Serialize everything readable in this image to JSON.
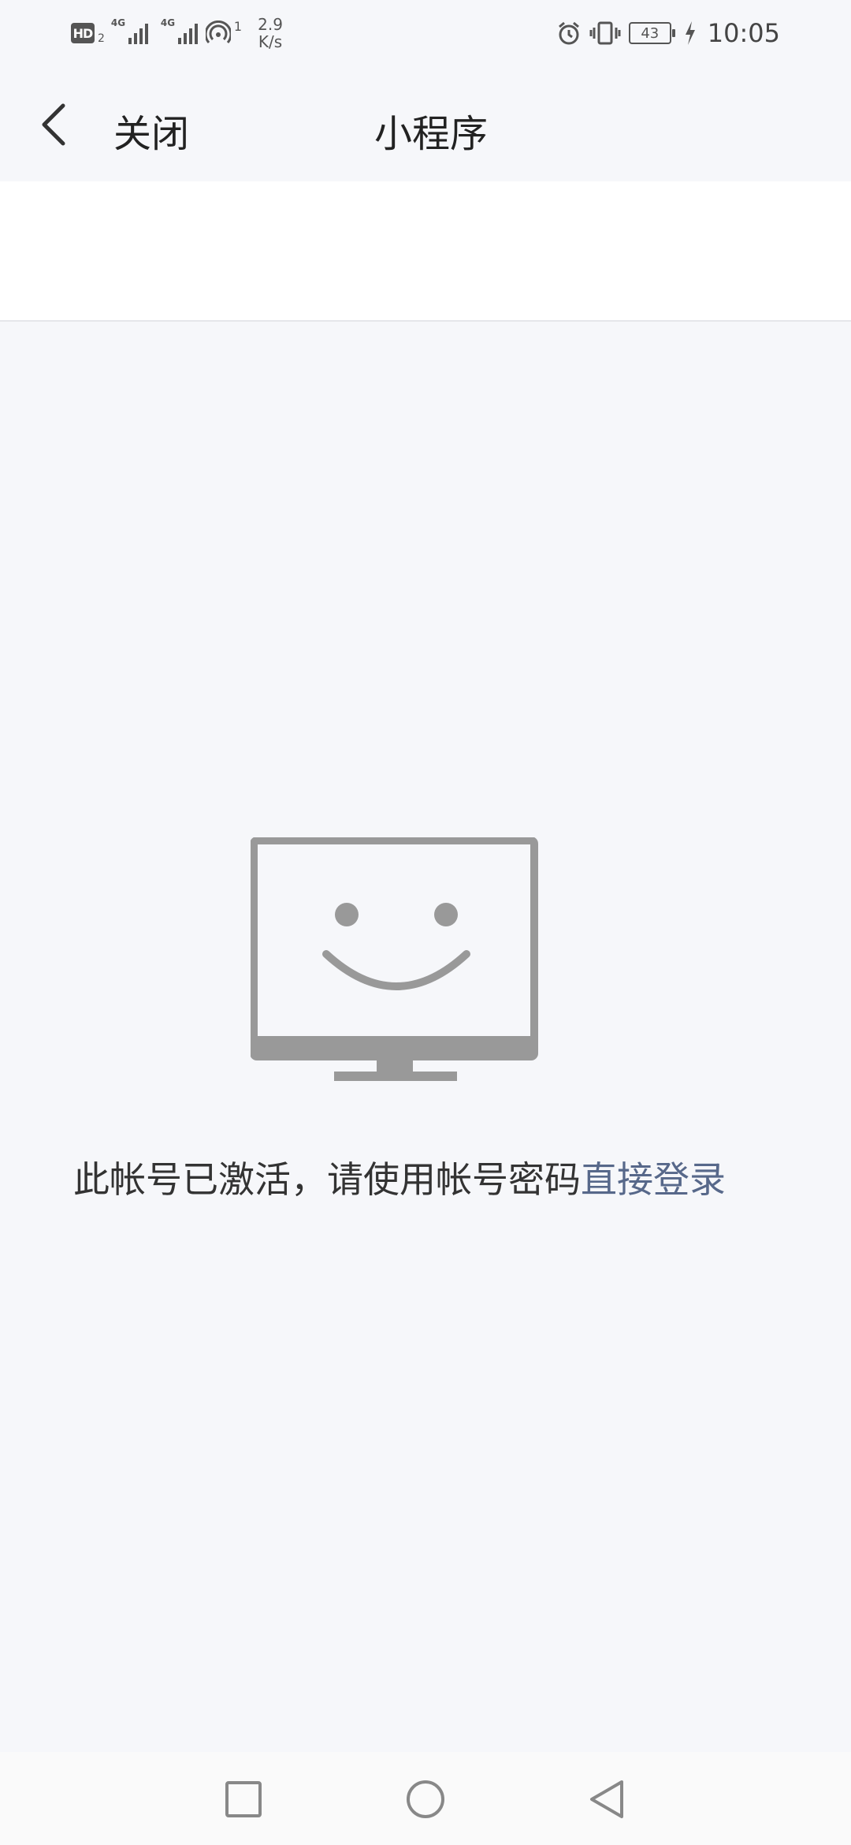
{
  "status_bar": {
    "hd_label": "HD",
    "hd_sub": "2",
    "network1": "4G",
    "network2": "4G",
    "hotspot_count": "1",
    "speed_value": "2.9",
    "speed_unit": "K/s",
    "battery": "43",
    "time": "10:05"
  },
  "header": {
    "close_label": "关闭",
    "title": "小程序"
  },
  "empty_state": {
    "message": "此帐号已激活，请使用帐号密码",
    "link_text": "直接登录"
  },
  "colors": {
    "background": "#f6f7fa",
    "link": "#57688a",
    "illustration": "#999999"
  }
}
